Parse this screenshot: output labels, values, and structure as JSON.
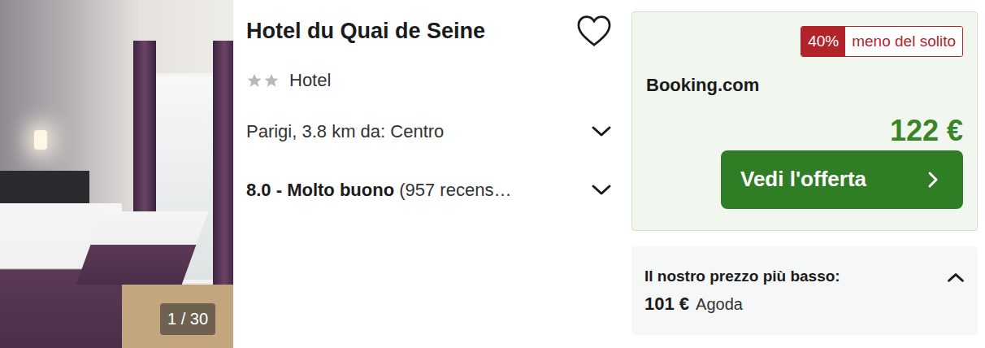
{
  "hotel": {
    "name": "Hotel du Quai de Seine",
    "favorite": false,
    "stars": 2,
    "type": "Hotel",
    "photo": {
      "counter": "1 / 30"
    },
    "location": {
      "text": "Parigi, 3.8 km da: Centro",
      "expanded": false
    },
    "rating": {
      "score": "8.0 - Molto buono",
      "reviews": "(957 recens…",
      "expanded": false
    }
  },
  "deal": {
    "discount": "40%",
    "discount_label": "meno del solito",
    "provider": "Booking.com",
    "price": "122 €",
    "button": "Vedi l'offerta"
  },
  "lowest": {
    "label": "Il nostro prezzo più basso:",
    "price": "101 €",
    "provider": "Agoda",
    "expanded": true
  }
}
